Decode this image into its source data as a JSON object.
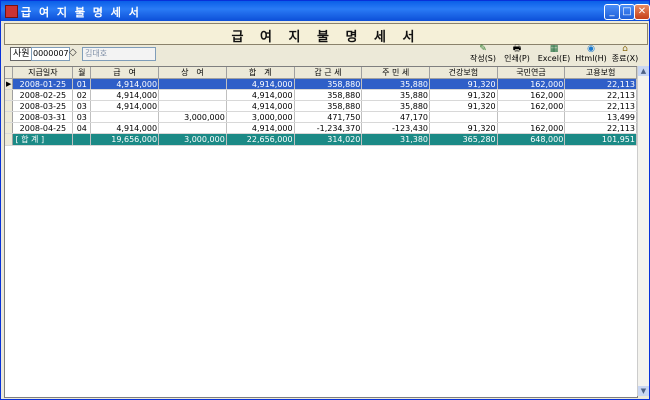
{
  "window": {
    "title": "급 여 지 불 명 세 서"
  },
  "banner": {
    "title": "급 여 지 불 명 세 서"
  },
  "employee": {
    "label": "사원",
    "code": "0000007",
    "name": "김대호"
  },
  "toolbar": [
    {
      "name": "write",
      "label": "작성(S)",
      "icon": "✎"
    },
    {
      "name": "print",
      "label": "인쇄(P)",
      "icon": "🖶"
    },
    {
      "name": "excel",
      "label": "Excel(E)",
      "icon": "▦"
    },
    {
      "name": "html",
      "label": "Html(H)",
      "icon": "◉"
    },
    {
      "name": "exit",
      "label": "종료(X)",
      "icon": "⌂"
    }
  ],
  "table": {
    "columns": [
      "지급일자",
      "월",
      "급　여",
      "상　여",
      "합　계",
      "갑 근 세",
      "주 민 세",
      "건강보험",
      "국민연금",
      "고용보험"
    ],
    "rows": [
      [
        "2008-01-25",
        "01",
        "4,914,000",
        "",
        "4,914,000",
        "358,880",
        "35,880",
        "91,320",
        "162,000",
        "22,113"
      ],
      [
        "2008-02-25",
        "02",
        "4,914,000",
        "",
        "4,914,000",
        "358,880",
        "35,880",
        "91,320",
        "162,000",
        "22,113"
      ],
      [
        "2008-03-25",
        "03",
        "4,914,000",
        "",
        "4,914,000",
        "358,880",
        "35,880",
        "91,320",
        "162,000",
        "22,113"
      ],
      [
        "2008-03-31",
        "03",
        "",
        "3,000,000",
        "3,000,000",
        "471,750",
        "47,170",
        "",
        "",
        "13,499"
      ],
      [
        "2008-04-25",
        "04",
        "4,914,000",
        "",
        "4,914,000",
        "-1,234,370",
        "-123,430",
        "91,320",
        "162,000",
        "22,113"
      ]
    ],
    "total": [
      "[ 합 계 ]",
      "",
      "19,656,000",
      "3,000,000",
      "22,656,000",
      "314,020",
      "31,380",
      "365,280",
      "648,000",
      "101,951"
    ]
  },
  "colors": {
    "selected_row": "#2F5FC8",
    "total_row": "#1B8A86",
    "titlebar": "#0A5FE8"
  }
}
